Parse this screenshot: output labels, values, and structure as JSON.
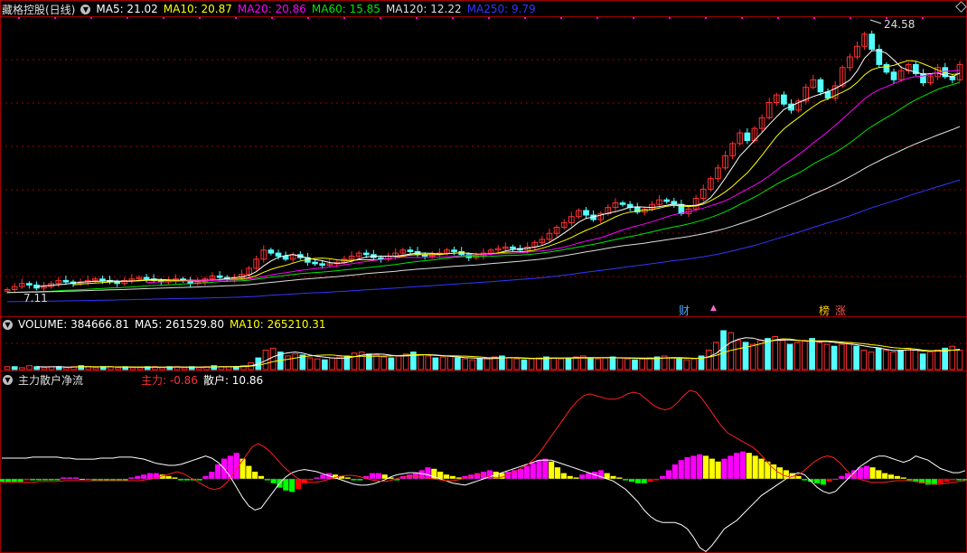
{
  "colors": {
    "up": "#ff3232",
    "down": "#54ffff",
    "ma5": "#ffffff",
    "ma10": "#ffff00",
    "ma20": "#ff00ff",
    "ma60": "#00e600",
    "ma120": "#dddddd",
    "ma250": "#3535ff",
    "grid": "#a00000",
    "main_pos": "#ff00ff",
    "main_pos2": "#ffff00",
    "main_neg": "#00ff00",
    "main_neg2": "#ff0000",
    "retail_line": "#ff2020",
    "white_line": "#ffffff"
  },
  "header": {
    "stock_title": "藏格控股(日线)",
    "ma_labels": [
      {
        "text": "MA5: 21.02",
        "color": "#ffffff"
      },
      {
        "text": "MA10: 20.87",
        "color": "#ffff00"
      },
      {
        "text": "MA20: 20.86",
        "color": "#ff00ff"
      },
      {
        "text": "MA60: 15.85",
        "color": "#00e600"
      },
      {
        "text": "MA120: 12.22",
        "color": "#dddddd"
      },
      {
        "text": "MA250: 9.79",
        "color": "#3535ff"
      }
    ],
    "high_label": "24.58",
    "low_label": "7.11",
    "markers": [
      {
        "text": "财",
        "color": "#4da6ff"
      },
      {
        "text": "▲",
        "color": "#ff66cc"
      },
      {
        "text": "榜",
        "color": "#ffcc00"
      },
      {
        "text": "涨",
        "color": "#ff5050"
      }
    ]
  },
  "volume_header": {
    "labels": [
      {
        "text": "VOLUME: 384666.81",
        "color": "#ffffff"
      },
      {
        "text": "MA5: 261529.80",
        "color": "#ffffff"
      },
      {
        "text": "MA10: 265210.31",
        "color": "#ffff00"
      }
    ]
  },
  "flow_header": {
    "title": "主力散户净流",
    "main_label": "主力: -0.86",
    "retail_label": "散户: 10.86",
    "main_color": "#ff3232",
    "retail_color": "#ffffff"
  },
  "chart_data": [
    {
      "type": "candlestick",
      "title": "藏格控股(日线)",
      "price_range": [
        7.11,
        24.58
      ],
      "latest": {
        "MA5": 21.02,
        "MA10": 20.87,
        "MA20": 20.86,
        "MA60": 15.85,
        "MA120": 12.22,
        "MA250": 9.79
      },
      "close": [
        7.2,
        7.4,
        7.6,
        7.5,
        7.3,
        7.4,
        7.6,
        7.8,
        7.7,
        7.6,
        7.7,
        7.8,
        7.9,
        7.8,
        7.7,
        7.6,
        7.8,
        7.9,
        8.0,
        7.9,
        7.8,
        7.7,
        7.8,
        7.9,
        7.8,
        7.6,
        7.7,
        7.9,
        8.1,
        8.0,
        7.9,
        8.0,
        8.2,
        8.6,
        9.2,
        9.8,
        9.6,
        9.4,
        9.2,
        9.5,
        9.3,
        9.0,
        8.9,
        8.8,
        8.9,
        9.0,
        9.2,
        9.4,
        9.6,
        9.5,
        9.3,
        9.2,
        9.4,
        9.6,
        9.8,
        9.7,
        9.5,
        9.4,
        9.5,
        9.6,
        9.8,
        9.7,
        9.5,
        9.3,
        9.4,
        9.6,
        9.8,
        9.9,
        10.0,
        9.9,
        9.8,
        10.0,
        10.3,
        10.5,
        10.9,
        11.3,
        11.6,
        12.0,
        12.4,
        12.1,
        11.8,
        12.2,
        12.6,
        12.9,
        12.8,
        12.6,
        12.3,
        12.5,
        12.8,
        13.1,
        13.0,
        12.8,
        12.2,
        12.5,
        13.2,
        13.8,
        14.5,
        15.2,
        16.0,
        16.8,
        17.5,
        17.0,
        17.8,
        18.5,
        19.5,
        20.0,
        19.4,
        19.0,
        19.6,
        20.5,
        21.0,
        20.2,
        19.8,
        20.6,
        21.8,
        22.5,
        23.2,
        24.0,
        23.0,
        22.0,
        21.5,
        21.0,
        21.6,
        22.0,
        21.4,
        20.8,
        21.2,
        21.8,
        21.2,
        21.0,
        22.0
      ]
    },
    {
      "type": "volume",
      "latest": {
        "VOLUME": 384666.81,
        "MA5": 261529.8,
        "MA10": 265210.31
      },
      "values": [
        3,
        3,
        2,
        4,
        3,
        2,
        3,
        3,
        2,
        3,
        4,
        3,
        2,
        3,
        3,
        2,
        3,
        2,
        2,
        3,
        3,
        2,
        3,
        3,
        2,
        3,
        2,
        3,
        4,
        3,
        3,
        3,
        4,
        7,
        12,
        20,
        22,
        18,
        14,
        16,
        15,
        12,
        11,
        10,
        12,
        13,
        14,
        17,
        18,
        16,
        15,
        13,
        12,
        14,
        16,
        18,
        15,
        14,
        12,
        13,
        14,
        12,
        11,
        10,
        11,
        12,
        13,
        14,
        12,
        11,
        10,
        11,
        12,
        13,
        12,
        11,
        12,
        13,
        14,
        12,
        11,
        12,
        13,
        12,
        11,
        10,
        11,
        12,
        13,
        14,
        12,
        11,
        10,
        11,
        14,
        20,
        28,
        40,
        38,
        30,
        28,
        26,
        30,
        32,
        34,
        30,
        26,
        28,
        30,
        32,
        28,
        26,
        24,
        26,
        28,
        24,
        20,
        18,
        22,
        20,
        18,
        20,
        22,
        20,
        16,
        18,
        20,
        22,
        24,
        20
      ]
    },
    {
      "type": "bar",
      "title": "主力散户净流",
      "latest": {
        "主力": -0.86,
        "散户": 10.86
      },
      "main_force": [
        -2,
        -2,
        -2,
        -2,
        -1,
        -1,
        -1,
        -1,
        -1,
        -1,
        1,
        1,
        1,
        0,
        0,
        -1,
        -1,
        -1,
        -1,
        -1,
        -1,
        1,
        2,
        3,
        4,
        4,
        3,
        2,
        1,
        -1,
        -1,
        -1,
        -1,
        2,
        5,
        10,
        14,
        16,
        18,
        14,
        9,
        5,
        2,
        -1,
        -3,
        -6,
        -8,
        -9,
        -7,
        -3,
        -1,
        1,
        3,
        4,
        3,
        2,
        1,
        -1,
        -1,
        2,
        4,
        4,
        3,
        1,
        -1,
        2,
        3,
        4,
        6,
        8,
        7,
        5,
        3,
        2,
        1,
        2,
        3,
        4,
        5,
        6,
        5,
        4,
        5,
        6,
        7,
        9,
        11,
        13,
        14,
        12,
        8,
        4,
        2,
        1,
        3,
        4,
        5,
        6,
        4,
        2,
        1,
        -1,
        -2,
        -3,
        -3,
        -2,
        -1,
        2,
        6,
        10,
        13,
        15,
        16,
        17,
        16,
        14,
        12,
        14,
        16,
        18,
        19,
        18,
        16,
        14,
        12,
        10,
        8,
        6,
        4,
        2,
        -1,
        -2,
        -3,
        -4,
        -2,
        0,
        2,
        4,
        6,
        8,
        9,
        8,
        6,
        4,
        3,
        2,
        1,
        -1,
        -2,
        -3,
        -4,
        -4,
        -3,
        -2,
        -1,
        -1,
        -1
      ],
      "retail_line": [
        20,
        20,
        20,
        20,
        20,
        21,
        21,
        21,
        21,
        21,
        20,
        20,
        19,
        19,
        19,
        19,
        20,
        20,
        20,
        21,
        21,
        21,
        20,
        19,
        17,
        15,
        14,
        13,
        13,
        14,
        16,
        18,
        20,
        22,
        20,
        16,
        10,
        2,
        -8,
        -18,
        -26,
        -30,
        -28,
        -20,
        -12,
        -4,
        2,
        6,
        8,
        9,
        8,
        7,
        5,
        3,
        1,
        -1,
        -3,
        -5,
        -6,
        -6,
        -5,
        -3,
        -1,
        2,
        4,
        5,
        6,
        6,
        5,
        4,
        2,
        0,
        -2,
        -4,
        -5,
        -6,
        -4,
        -2,
        0,
        2,
        4,
        6,
        8,
        10,
        12,
        14,
        16,
        18,
        18,
        18,
        16,
        14,
        12,
        10,
        8,
        6,
        4,
        2,
        0,
        -2,
        -6,
        -10,
        -16,
        -22,
        -30,
        -36,
        -40,
        -42,
        -42,
        -42,
        -44,
        -48,
        -56,
        -66,
        -70,
        -64,
        -56,
        -48,
        -44,
        -40,
        -34,
        -28,
        -22,
        -16,
        -12,
        -8,
        -4,
        0,
        4,
        6,
        4,
        -2,
        -8,
        -12,
        -14,
        -12,
        -6,
        0,
        6,
        12,
        16,
        20,
        22,
        22,
        20,
        18,
        16,
        18,
        22,
        20,
        18,
        14,
        10,
        8,
        6,
        6,
        8
      ],
      "main_line": [
        -4,
        -4,
        -4,
        -4,
        -4,
        -4,
        -3,
        -3,
        -3,
        -3,
        -2,
        -2,
        -2,
        -2,
        -2,
        -2,
        -2,
        -2,
        -2,
        -2,
        -2,
        -2,
        -2,
        -1,
        0,
        2,
        4,
        6,
        8,
        6,
        2,
        -2,
        -6,
        -10,
        -12,
        -10,
        -4,
        6,
        16,
        26,
        36,
        40,
        36,
        30,
        22,
        14,
        8,
        2,
        -2,
        -4,
        -4,
        -3,
        -1,
        1,
        3,
        4,
        4,
        3,
        1,
        -1,
        -2,
        -3,
        -2,
        0,
        2,
        3,
        3,
        2,
        1,
        0,
        -1,
        -2,
        -2,
        -1,
        1,
        3,
        5,
        4,
        2,
        1,
        2,
        5,
        8,
        12,
        16,
        22,
        30,
        40,
        50,
        60,
        70,
        80,
        88,
        94,
        96,
        94,
        92,
        90,
        90,
        92,
        96,
        98,
        96,
        90,
        84,
        80,
        78,
        80,
        86,
        94,
        100,
        98,
        90,
        80,
        70,
        60,
        52,
        48,
        44,
        40,
        36,
        30,
        22,
        14,
        8,
        4,
        2,
        4,
        8,
        14,
        20,
        24,
        26,
        24,
        18,
        10,
        4,
        0,
        -2,
        -4,
        -4,
        -4,
        -3,
        -2,
        -2,
        -2,
        -3,
        -4,
        -5,
        -6,
        -6,
        -5,
        -4,
        -3,
        -2
      ]
    }
  ]
}
